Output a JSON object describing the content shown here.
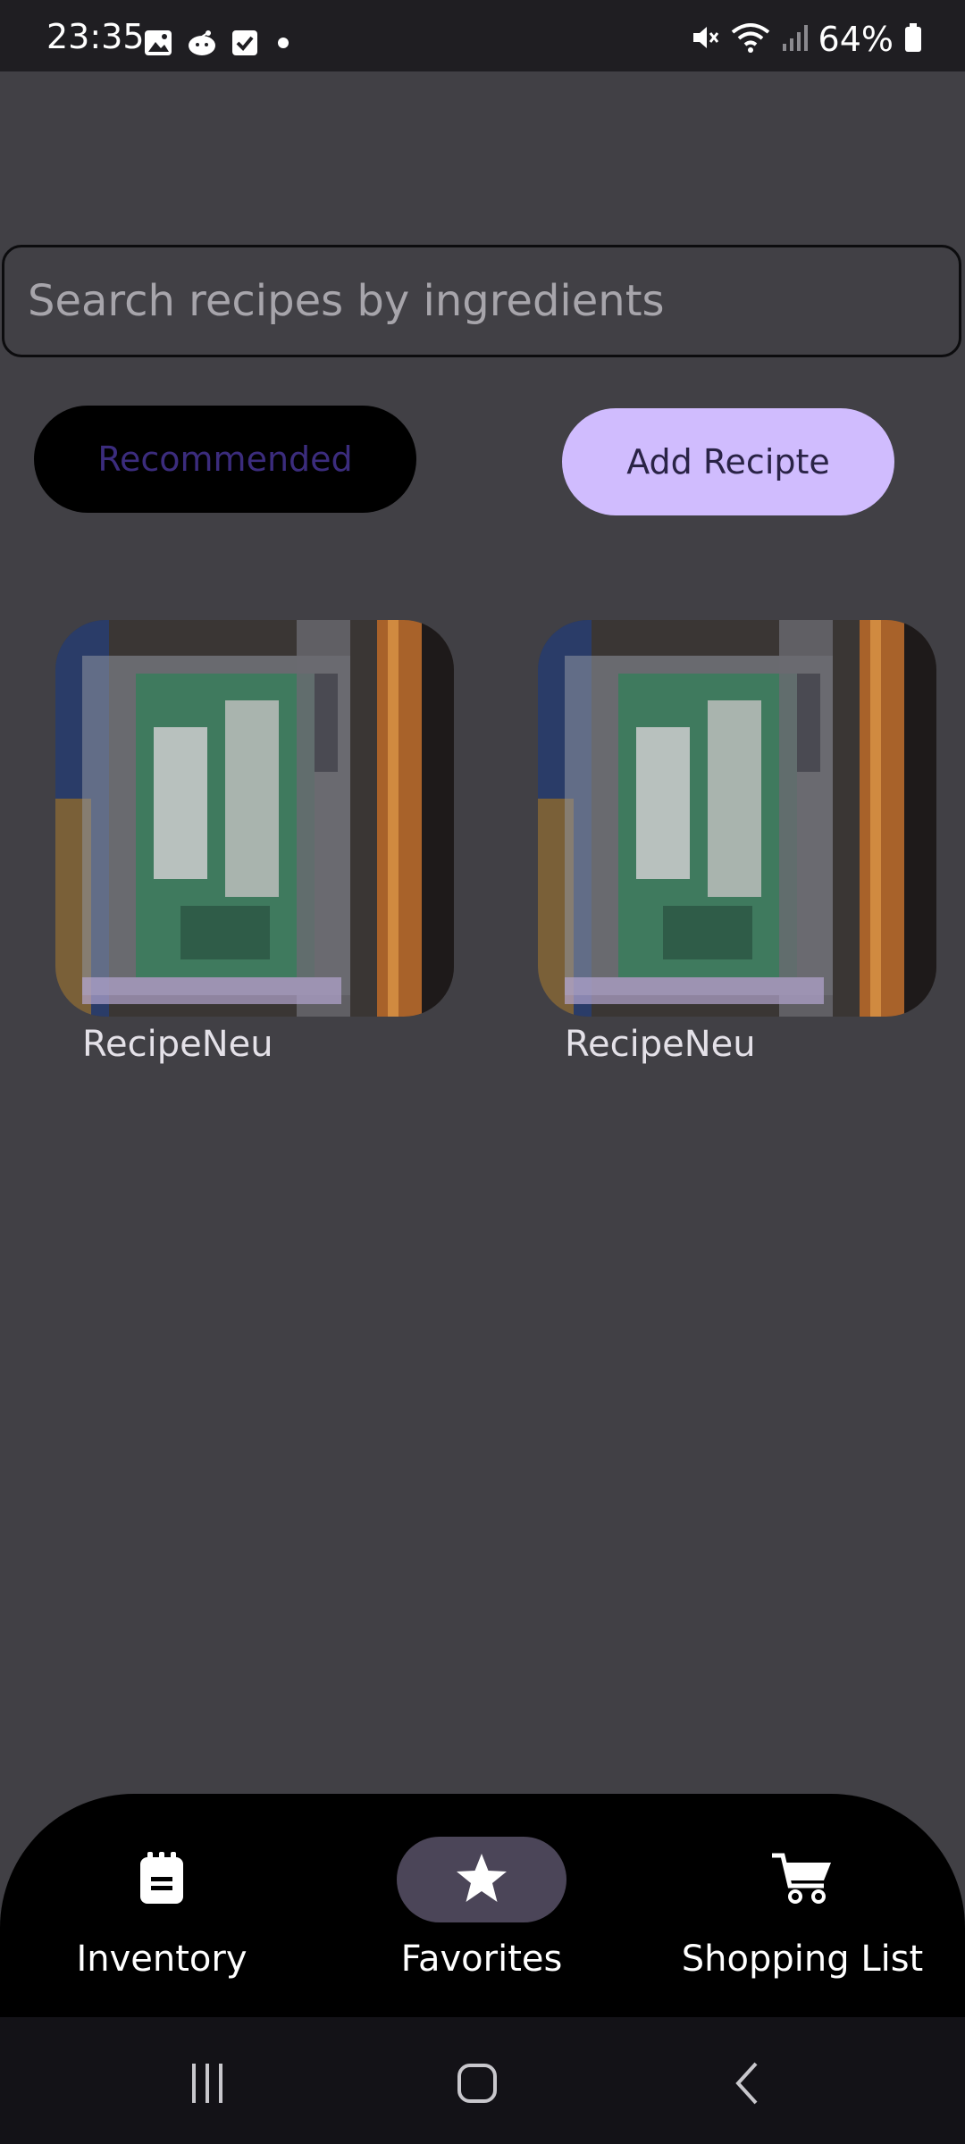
{
  "status_bar": {
    "time": "23:35",
    "battery": "64%",
    "left_icons": [
      "gallery-icon",
      "app-icon",
      "checkbox-icon",
      "dot-icon"
    ],
    "right_icons": [
      "mute-icon",
      "wifi-icon",
      "signal-icon",
      "battery-icon"
    ]
  },
  "search": {
    "placeholder": "Search recipes by ingredients",
    "value": ""
  },
  "buttons": {
    "recommended": "Recommended",
    "add_recipe": "Add Recipte"
  },
  "recipes": [
    {
      "title": "RecipeNeu",
      "image": "raspberry-pi-photo"
    },
    {
      "title": "RecipeNeu",
      "image": "raspberry-pi-photo"
    }
  ],
  "bottom_nav": {
    "items": [
      {
        "label": "Inventory",
        "icon": "notepad-icon",
        "active": false
      },
      {
        "label": "Favorites",
        "icon": "star-icon",
        "active": true
      },
      {
        "label": "Shopping List",
        "icon": "cart-icon",
        "active": false
      }
    ]
  },
  "system_nav": {
    "buttons": [
      "recents-icon",
      "home-icon",
      "back-icon"
    ]
  },
  "colors": {
    "background": "#414045",
    "accent": "#d0bcfe",
    "nav_active": "#4b4558"
  }
}
